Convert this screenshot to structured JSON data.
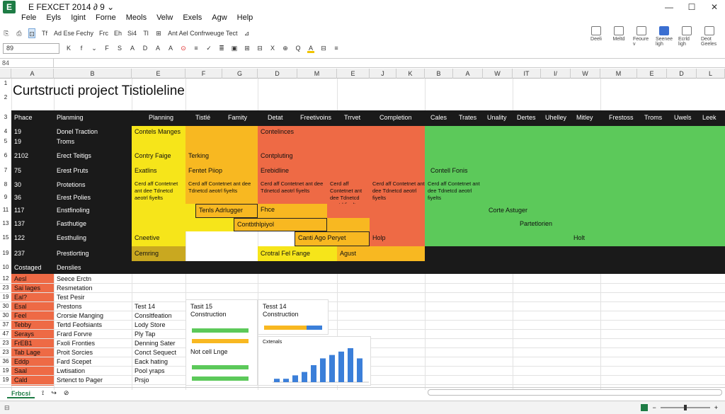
{
  "window": {
    "title": "E FEXCET 2014 ∂ 9 ⌄",
    "app_icon_letter": "E"
  },
  "menu": [
    "Fele",
    "Eyls",
    "Igint",
    "Forne",
    "Meols",
    "Velw",
    "Exels",
    "Agw",
    "Help"
  ],
  "toolbar1": {
    "items": [
      "⎘",
      "⎙",
      "⊡",
      "Tf",
      "Ad Ese Fechy",
      "Frc",
      "Eh",
      "Si4",
      "Tl",
      "⊞",
      "Ant Ael Confrweuge Tect",
      "⊿"
    ],
    "ribbon_buttons": [
      "Deeli",
      "Meltd",
      "Feoure v",
      "Seenee ligh",
      "Ecrld ligh",
      "Deot Geeles"
    ]
  },
  "toolbar2": {
    "namebox": "89",
    "items": [
      "K",
      "f",
      "⌄",
      "F",
      "S",
      "A",
      "D",
      "A",
      "A",
      "⊙",
      "≡",
      "✓",
      "≣",
      "▣",
      "⊞",
      "⊟",
      "X",
      "⊕",
      "Q",
      "A",
      "⊟",
      "≡"
    ]
  },
  "formula_bar": {
    "cell_ref": "84"
  },
  "columns": [
    "A",
    "B",
    "E",
    "F",
    "G",
    "D",
    "M",
    "E",
    "J",
    "K",
    "B",
    "A",
    "W",
    "IT",
    "I/",
    "W",
    "M",
    "E",
    "D",
    "L"
  ],
  "title": "Curtstructi project Tistioleline",
  "header_row": {
    "num": "3",
    "cells": [
      "Phace",
      "Planming",
      "Planning",
      "Tistlé",
      "Famity",
      "Detat",
      "Freetivoins",
      "Trrvet",
      "Completion",
      "Cales",
      "Trates",
      "Unality",
      "Dertes",
      "Uhelley",
      "Mitley",
      "Frestoss",
      "Troms",
      "Uwels",
      "Leek"
    ]
  },
  "rows": [
    {
      "nums": [
        "4",
        "5"
      ],
      "phase": [
        "19",
        "19"
      ],
      "task": [
        "Donel Traction",
        "Troms"
      ],
      "c1": "Contels Manges",
      "c2": "Contelinces"
    },
    {
      "nums": [
        "6"
      ],
      "phase": [
        "2102"
      ],
      "task": [
        "Erect Teitigs"
      ],
      "c1": "Contry Faige",
      "c2": "Terking",
      "c3": "Contpluting"
    },
    {
      "nums": [
        "7"
      ],
      "phase": [
        "75"
      ],
      "task": [
        "Erest Pruts"
      ],
      "c1": "Exatlins",
      "c2": "Fentet Piiop",
      "c3": "Erebidline",
      "c4": "Contell Fonis"
    },
    {
      "nums": [
        "8",
        "9"
      ],
      "phase": [
        "30",
        "36"
      ],
      "task": [
        "Protetions",
        "Erest Polies"
      ],
      "wrap": "Cerd aff Contetnet ant dee Tdnetcd aeotrl fiyelts"
    },
    {
      "nums": [
        "11"
      ],
      "phase": [
        "117"
      ],
      "task": [
        "Enstfinoling"
      ],
      "c1": "Tenls Adrlugger",
      "c2": "Fhce",
      "c3": "Corte Astuger"
    },
    {
      "nums": [
        "13"
      ],
      "phase": [
        "137"
      ],
      "task": [
        "Fasthutige"
      ],
      "c1": "Contbthlpiyol",
      "c2": "Partetlorien"
    },
    {
      "nums": [
        "15"
      ],
      "phase": [
        "122"
      ],
      "task": [
        "Eesthuling"
      ],
      "c1": "Cneetive",
      "c2": "Canti Ago Peryet",
      "c3": "Holp",
      "c4": "Holt"
    },
    {
      "nums": [
        "19"
      ],
      "phase": [
        "237"
      ],
      "task": [
        "Prestlorting"
      ],
      "c1": "Cemring",
      "c2": "Crotral Fel Fange",
      "c3": "Agust"
    }
  ],
  "section_header": {
    "num": "10",
    "left": "Costaged",
    "right": "Denslies"
  },
  "lower_rows": [
    {
      "num": "12",
      "a": "Aesl",
      "b": "Seece Erctn"
    },
    {
      "num": "23",
      "a": "Sai lages",
      "b": "Resmetation"
    },
    {
      "num": "19",
      "a": "Eal?",
      "b": "Test Pesir"
    },
    {
      "num": "30",
      "a": "Esal",
      "b": "Prestons",
      "c": "Test 14"
    },
    {
      "num": "30",
      "a": "Feel",
      "b": "Crorsie Manging",
      "c": "Consltfeation"
    },
    {
      "num": "37",
      "a": "Tebby",
      "b": "Tertd Feofsiants",
      "c": "Lody Store"
    },
    {
      "num": "47",
      "a": "Serays",
      "b": "Frard Forvre",
      "c": "Ply Tap"
    },
    {
      "num": "23",
      "a": "FrEB1",
      "b": "Fxoli Fronties",
      "c": "Denning Sater"
    },
    {
      "num": "23",
      "a": "Tab Lage",
      "b": "Proit Sorcies",
      "c": "Conct Sequect"
    },
    {
      "num": "36",
      "a": "Eddp",
      "b": "Fard Scepet",
      "c": "Eack hating"
    },
    {
      "num": "19",
      "a": "Saal",
      "b": "Lwtisation",
      "c": "Pool yraps"
    },
    {
      "num": "19",
      "a": "Cald",
      "b": "Srtenct to Pager",
      "c": "Prsjo"
    }
  ],
  "mini_panels": [
    {
      "head": "Tasit 15",
      "title": "Construction",
      "sub": "Not cell Lnge"
    },
    {
      "head": "Tesst 14",
      "title": "Construction",
      "sub": "Cxtenals"
    }
  ],
  "mini_chart": {
    "type": "bar",
    "values": [
      1,
      1,
      2,
      3,
      5,
      7,
      8,
      9,
      10,
      7
    ]
  },
  "sheet_tab": "Frbcsi",
  "status": {
    "text": "⊟",
    "zoom_minus": "−",
    "zoom_plus": "+"
  }
}
